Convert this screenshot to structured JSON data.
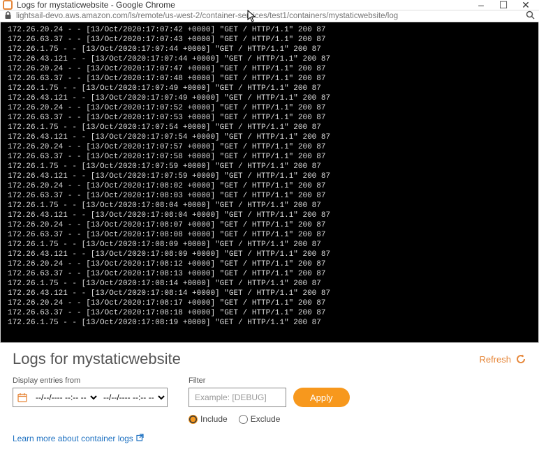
{
  "window": {
    "title": "Logs for mystaticwebsite - Google Chrome"
  },
  "address": {
    "url": "lightsail-devo.aws.amazon.com/ls/remote/us-west-2/container-services/test1/containers/mystaticwebsite/log"
  },
  "page": {
    "heading": "Logs for mystaticwebsite",
    "refresh_label": "Refresh",
    "display_label": "Display entries from",
    "filter_label": "Filter",
    "filter_placeholder": "Example: [DEBUG]",
    "apply_label": "Apply",
    "include_label": "Include",
    "exclude_label": "Exclude",
    "learnmore_label": "Learn more about container logs",
    "date_from": "--/--/---- --:--  --",
    "date_to": "--/--/---- --:--  --"
  },
  "log_lines": [
    "172.26.20.24 - - [13/Oct/2020:17:07:42 +0000] \"GET / HTTP/1.1\" 200 87",
    "172.26.63.37 - - [13/Oct/2020:17:07:43 +0000] \"GET / HTTP/1.1\" 200 87",
    "172.26.1.75 - - [13/Oct/2020:17:07:44 +0000] \"GET / HTTP/1.1\" 200 87",
    "172.26.43.121 - - [13/Oct/2020:17:07:44 +0000] \"GET / HTTP/1.1\" 200 87",
    "172.26.20.24 - - [13/Oct/2020:17:07:47 +0000] \"GET / HTTP/1.1\" 200 87",
    "172.26.63.37 - - [13/Oct/2020:17:07:48 +0000] \"GET / HTTP/1.1\" 200 87",
    "172.26.1.75 - - [13/Oct/2020:17:07:49 +0000] \"GET / HTTP/1.1\" 200 87",
    "172.26.43.121 - - [13/Oct/2020:17:07:49 +0000] \"GET / HTTP/1.1\" 200 87",
    "172.26.20.24 - - [13/Oct/2020:17:07:52 +0000] \"GET / HTTP/1.1\" 200 87",
    "172.26.63.37 - - [13/Oct/2020:17:07:53 +0000] \"GET / HTTP/1.1\" 200 87",
    "172.26.1.75 - - [13/Oct/2020:17:07:54 +0000] \"GET / HTTP/1.1\" 200 87",
    "172.26.43.121 - - [13/Oct/2020:17:07:54 +0000] \"GET / HTTP/1.1\" 200 87",
    "172.26.20.24 - - [13/Oct/2020:17:07:57 +0000] \"GET / HTTP/1.1\" 200 87",
    "172.26.63.37 - - [13/Oct/2020:17:07:58 +0000] \"GET / HTTP/1.1\" 200 87",
    "172.26.1.75 - - [13/Oct/2020:17:07:59 +0000] \"GET / HTTP/1.1\" 200 87",
    "172.26.43.121 - - [13/Oct/2020:17:07:59 +0000] \"GET / HTTP/1.1\" 200 87",
    "172.26.20.24 - - [13/Oct/2020:17:08:02 +0000] \"GET / HTTP/1.1\" 200 87",
    "172.26.63.37 - - [13/Oct/2020:17:08:03 +0000] \"GET / HTTP/1.1\" 200 87",
    "172.26.1.75 - - [13/Oct/2020:17:08:04 +0000] \"GET / HTTP/1.1\" 200 87",
    "172.26.43.121 - - [13/Oct/2020:17:08:04 +0000] \"GET / HTTP/1.1\" 200 87",
    "172.26.20.24 - - [13/Oct/2020:17:08:07 +0000] \"GET / HTTP/1.1\" 200 87",
    "172.26.63.37 - - [13/Oct/2020:17:08:08 +0000] \"GET / HTTP/1.1\" 200 87",
    "172.26.1.75 - - [13/Oct/2020:17:08:09 +0000] \"GET / HTTP/1.1\" 200 87",
    "172.26.43.121 - - [13/Oct/2020:17:08:09 +0000] \"GET / HTTP/1.1\" 200 87",
    "172.26.20.24 - - [13/Oct/2020:17:08:12 +0000] \"GET / HTTP/1.1\" 200 87",
    "172.26.63.37 - - [13/Oct/2020:17:08:13 +0000] \"GET / HTTP/1.1\" 200 87",
    "172.26.1.75 - - [13/Oct/2020:17:08:14 +0000] \"GET / HTTP/1.1\" 200 87",
    "172.26.43.121 - - [13/Oct/2020:17:08:14 +0000] \"GET / HTTP/1.1\" 200 87",
    "172.26.20.24 - - [13/Oct/2020:17:08:17 +0000] \"GET / HTTP/1.1\" 200 87",
    "172.26.63.37 - - [13/Oct/2020:17:08:18 +0000] \"GET / HTTP/1.1\" 200 87",
    "172.26.1.75 - - [13/Oct/2020:17:08:19 +0000] \"GET / HTTP/1.1\" 200 87"
  ]
}
